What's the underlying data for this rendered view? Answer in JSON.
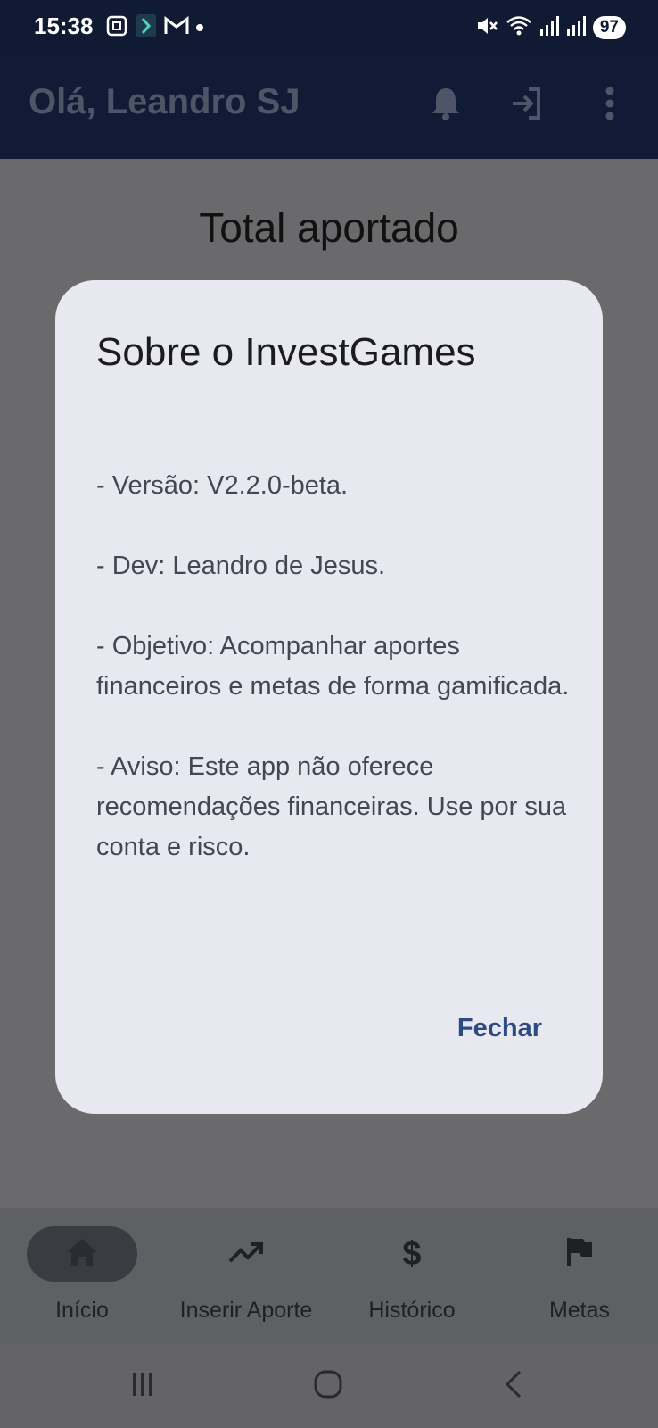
{
  "status_bar": {
    "time": "15:38",
    "battery": "97",
    "icons_left": [
      "screenshot-icon",
      "app-icon",
      "gmail-icon",
      "notification-dot-icon"
    ],
    "icons_right": [
      "mute-icon",
      "wifi-icon",
      "signal-icon",
      "signal-icon",
      "battery-icon"
    ]
  },
  "app_bar": {
    "title": "Olá, Leandro SJ",
    "actions": [
      "notifications-icon",
      "logout-icon",
      "more-vert-icon"
    ]
  },
  "background": {
    "total_title": "Total aportado"
  },
  "dialog": {
    "title": "Sobre o InvestGames",
    "paragraphs": [
      "- Versão: V2.2.0-beta.",
      "- Dev: Leandro de Jesus.",
      "- Objetivo: Acompanhar aportes financeiros e metas de forma gamificada.",
      "- Aviso: Este app não oferece recomendações financeiras. Use por sua conta e risco."
    ],
    "close_label": "Fechar"
  },
  "bottom_nav": {
    "items": [
      {
        "label": "Início",
        "icon": "home-icon",
        "active": true
      },
      {
        "label": "Inserir Aporte",
        "icon": "trending-up-icon",
        "active": false
      },
      {
        "label": "Histórico",
        "icon": "dollar-icon",
        "active": false
      },
      {
        "label": "Metas",
        "icon": "flag-icon",
        "active": false
      }
    ]
  },
  "system_nav": [
    "recents-button",
    "home-button",
    "back-button"
  ],
  "colors": {
    "status_bar_bg": "#101a33",
    "app_bar_bg": "#111b35",
    "scrim": "#6a6a6d",
    "dialog_bg": "#e8e8f1",
    "dialog_button": "#2e4a82"
  }
}
